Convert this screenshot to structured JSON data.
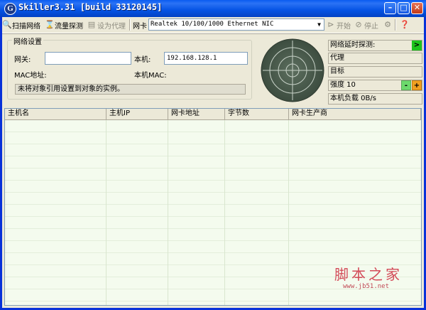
{
  "window": {
    "title": "Skiller3.31 [build 33120145]",
    "app_icon": "G"
  },
  "toolbar": {
    "scan_label": "扫描网络",
    "flow_label": "流量探测",
    "proxy_label": "设为代理",
    "nic_label": "网卡",
    "nic_value": "Realtek 10/100/1000 Ethernet NIC",
    "start_label": "开始",
    "stop_label": "停止"
  },
  "settings": {
    "group_title": "网络设置",
    "gateway_label": "网关:",
    "gateway_value": "",
    "local_label": "本机:",
    "local_value": "192.168.128.1",
    "mac_label": "MAC地址:",
    "local_mac_label": "本机MAC:",
    "status_text": "未将对象引用设置到对象的实例。"
  },
  "right_panel": {
    "latency_label": "网络延时探测:",
    "proxy_label": "代理",
    "target_label": "目标",
    "strength_label": "强度 10",
    "minus": "-",
    "plus": "+",
    "load_label": "本机负载 0B/s"
  },
  "table": {
    "columns": [
      "主机名",
      "主机IP",
      "网卡地址",
      "字节数",
      "网卡生产商"
    ]
  },
  "watermark": {
    "main": "脚本之家",
    "sub": "www.jb51.net"
  },
  "colors": {
    "titlebar": "#0553e4",
    "go_green": "#1ec41e",
    "plus_orange": "#f0a020",
    "minus_green": "#6cd96c"
  }
}
